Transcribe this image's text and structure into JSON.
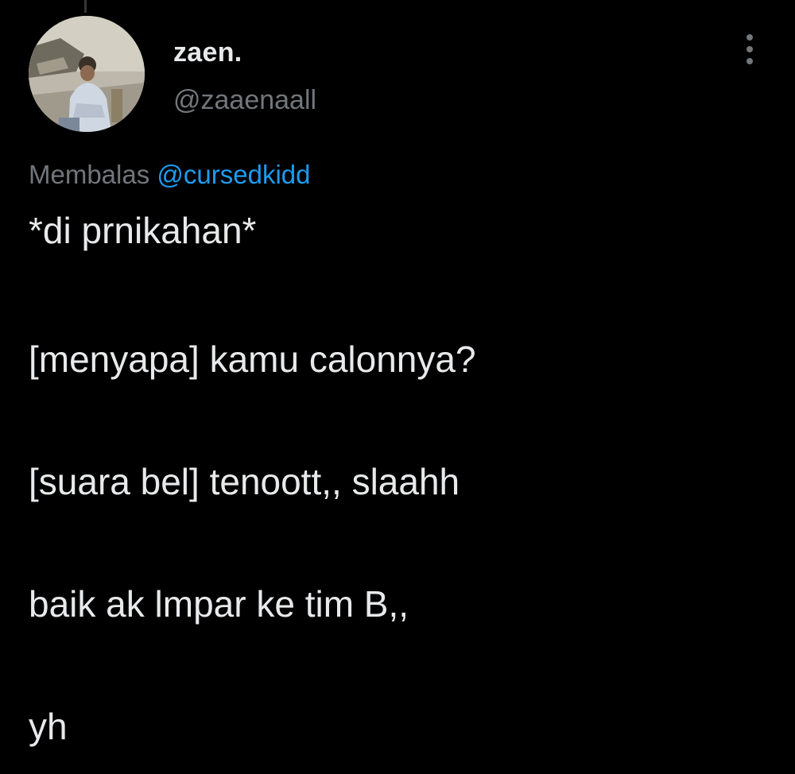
{
  "tweet": {
    "author": {
      "display_name": "zaen.",
      "handle": "@zaaenaall",
      "avatar": "profile-photo"
    },
    "more_icon": "more-options-vertical-icon",
    "reply_context": {
      "prefix": "Membalas",
      "mention": "@cursedkidd"
    },
    "lines": [
      "*di prnikahan*",
      "[menyapa] kamu calonnya?",
      "[suara bel] tenoott,, slaahh",
      "baik ak lmpar ke tim B,,",
      "yh"
    ]
  },
  "colors": {
    "background": "#000000",
    "primary_text": "#e7e9ea",
    "secondary_text": "#71767b",
    "mention": "#1d9bf0"
  }
}
